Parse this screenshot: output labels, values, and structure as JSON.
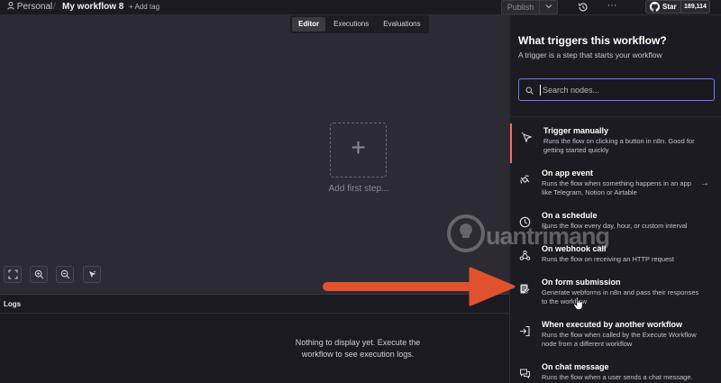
{
  "topbar": {
    "project": "Personal",
    "separator": "/",
    "workflow_name": "My workflow 8",
    "add_tag": "+ Add tag",
    "publish": "Publish",
    "star_label": "Star",
    "star_count": "189,114"
  },
  "canvas": {
    "tabs": [
      {
        "label": "Editor",
        "active": true
      },
      {
        "label": "Executions",
        "active": false
      },
      {
        "label": "Evaluations",
        "active": false
      }
    ],
    "add_first_step": "Add first step...",
    "controls": [
      "fit-view-icon",
      "zoom-in-icon",
      "zoom-out-icon",
      "tidy-up-icon"
    ]
  },
  "logs": {
    "title": "Logs",
    "empty_message": "Nothing to display yet. Execute the workflow to see execution logs."
  },
  "panel": {
    "title": "What triggers this workflow?",
    "subtitle": "A trigger is a step that starts your workflow",
    "search_placeholder": "Search nodes...",
    "items": [
      {
        "title": "Trigger manually",
        "desc": "Runs the flow on clicking a button in n8n. Good for getting started quickly",
        "icon": "cursor-click-icon",
        "active": true
      },
      {
        "title": "On app event",
        "desc": "Runs the flow when something happens in an app like Telegram, Notion or Airtable",
        "icon": "satellite-icon",
        "arrow": "→"
      },
      {
        "title": "On a schedule",
        "desc": "Runs the flow every day, hour, or custom interval",
        "icon": "clock-icon"
      },
      {
        "title": "On webhook call",
        "desc": "Runs the flow on receiving an HTTP request",
        "icon": "webhook-icon"
      },
      {
        "title": "On form submission",
        "desc": "Generate webforms in n8n and pass their responses to the workflow",
        "icon": "form-icon"
      },
      {
        "title": "When executed by another workflow",
        "desc": "Runs the flow when called by the Execute Workflow node from a different workflow",
        "icon": "sign-in-icon"
      },
      {
        "title": "On chat message",
        "desc": "Runs the flow when a user sends a chat message. For",
        "icon": "chat-icon"
      }
    ]
  },
  "watermark": {
    "text": "uantrimang"
  },
  "colors": {
    "accent": "#ff6d5a",
    "focus": "#6d7cff",
    "annotation_arrow": "#e0522d"
  }
}
